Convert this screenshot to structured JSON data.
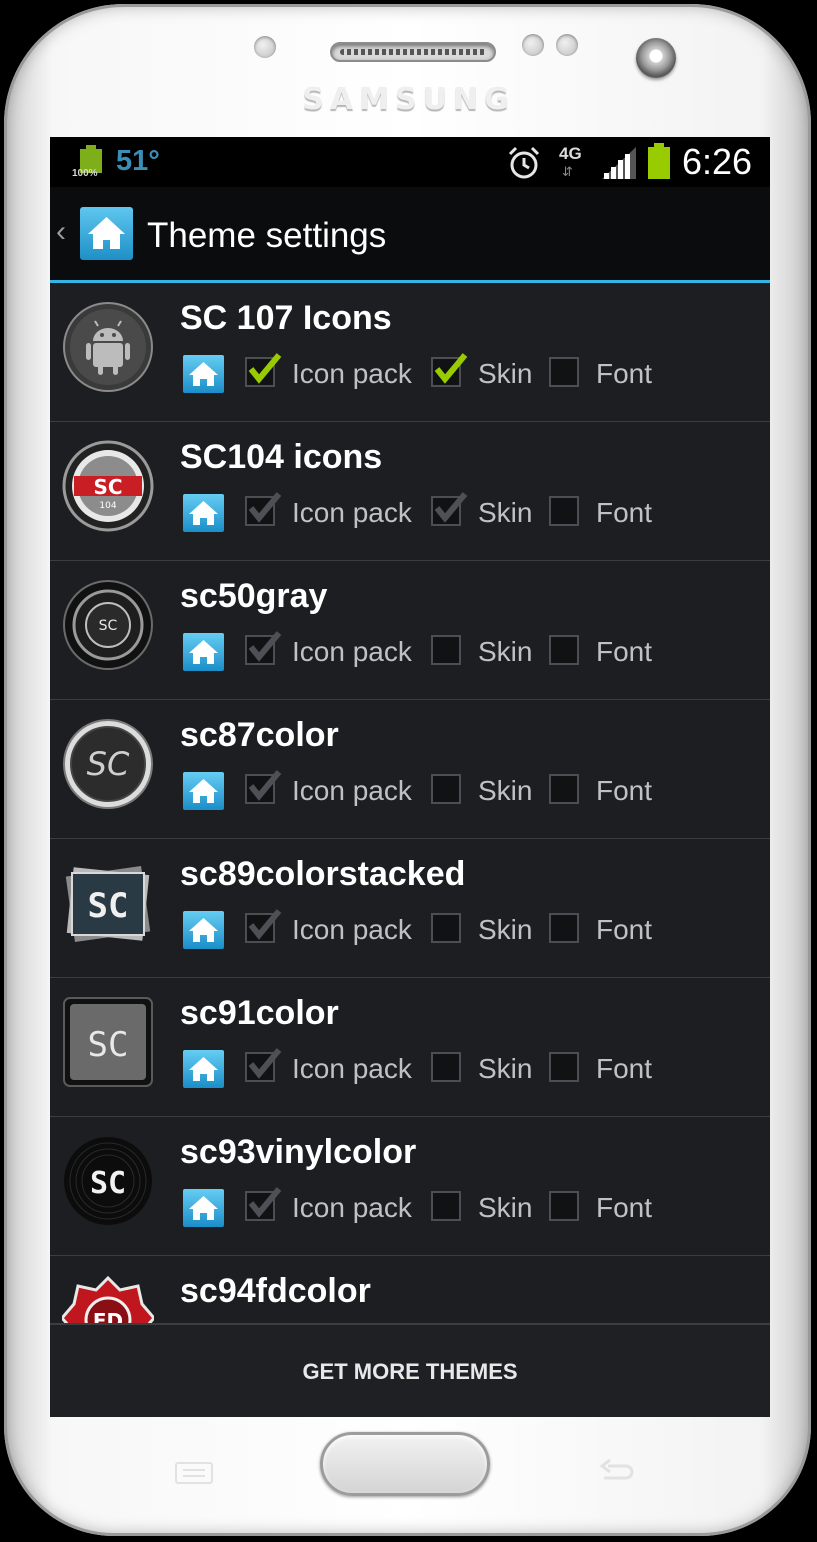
{
  "device": {
    "brand": "SAMSUNG"
  },
  "status_bar": {
    "battery_small_label": "100%",
    "temperature": "51°",
    "network": "4G",
    "network_arrows": "⇵",
    "time": "6:26"
  },
  "action_bar": {
    "back_glyph": "‹",
    "title": "Theme settings"
  },
  "themes": [
    {
      "name": "SC 107 Icons",
      "icon": "android-round-icon",
      "icon_pack": true,
      "icon_pack_state": "checked",
      "skin": true,
      "skin_state": "checked",
      "font": false
    },
    {
      "name": "SC104 icons",
      "icon": "sc104-logo-icon",
      "icon_pack": true,
      "icon_pack_state": "disabled-checked",
      "skin": true,
      "skin_state": "disabled-checked",
      "font": false
    },
    {
      "name": "sc50gray",
      "icon": "sc50gray-logo-icon",
      "icon_pack": true,
      "icon_pack_state": "disabled-checked",
      "skin": false,
      "font": false
    },
    {
      "name": "sc87color",
      "icon": "sc87color-logo-icon",
      "icon_pack": true,
      "icon_pack_state": "disabled-checked",
      "skin": false,
      "font": false
    },
    {
      "name": "sc89colorstacked",
      "icon": "sc89colorstacked-logo-icon",
      "icon_pack": true,
      "icon_pack_state": "disabled-checked",
      "skin": false,
      "font": false
    },
    {
      "name": "sc91color",
      "icon": "sc91color-logo-icon",
      "icon_pack": true,
      "icon_pack_state": "disabled-checked",
      "skin": false,
      "font": false
    },
    {
      "name": "sc93vinylcolor",
      "icon": "sc93vinylcolor-logo-icon",
      "icon_pack": true,
      "icon_pack_state": "disabled-checked",
      "skin": false,
      "font": false
    },
    {
      "name": "sc94fdcolor",
      "icon": "sc94fdcolor-logo-icon",
      "icon_pack": false,
      "skin": false,
      "font": false
    }
  ],
  "labels": {
    "icon_pack": "Icon pack",
    "skin": "Skin",
    "font": "Font"
  },
  "footer": {
    "button_label": "GET MORE THEMES"
  },
  "logo_text": {
    "sc": "SC",
    "sc104_sub": "104",
    "fd": "FD"
  },
  "colors": {
    "accent": "#33b5e5",
    "check_active": "#99cc00",
    "battery": "#99cc00",
    "temperature": "#3a8fb6"
  }
}
